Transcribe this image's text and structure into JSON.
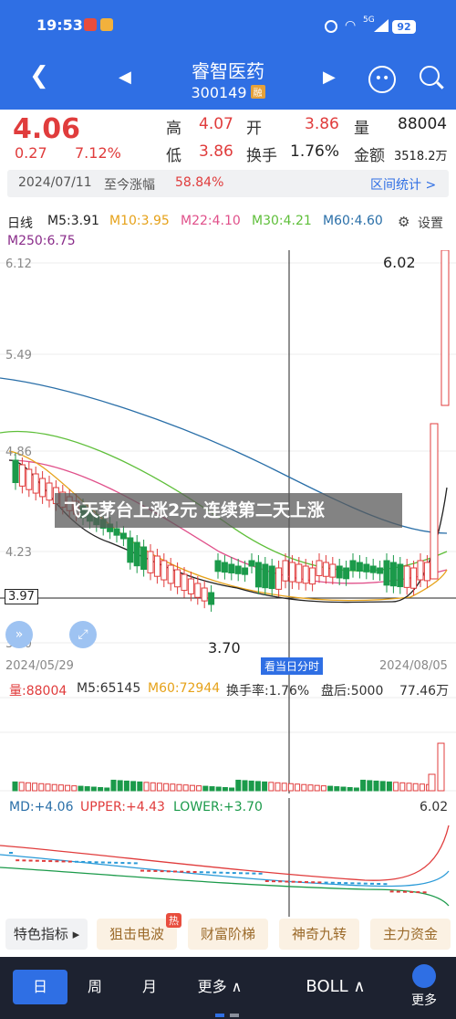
{
  "status_bar": {
    "time": "19:53",
    "network": "5G",
    "battery": "92"
  },
  "nav": {
    "title": "睿智医药",
    "code": "300149",
    "badge": "融"
  },
  "quote": {
    "price": "4.06",
    "change": "0.27",
    "change_pct": "7.12%",
    "high_label": "高",
    "high": "4.07",
    "open_label": "开",
    "open": "3.86",
    "vol_label": "量",
    "vol": "88004",
    "low_label": "低",
    "low": "3.86",
    "turnover_label": "换手",
    "turnover": "1.76%",
    "amount_label": "金额",
    "amount": "3518.2万"
  },
  "info": {
    "date": "2024/07/11",
    "since_label": "至今涨幅",
    "since_value": "58.84%",
    "interval_link": "区间统计 >"
  },
  "ma_row": {
    "kline": "日线",
    "ma5": "M5:3.91",
    "ma10": "M10:3.95",
    "ma22": "M22:4.10",
    "ma30": "M30:4.21",
    "ma60": "M60:4.60",
    "ma250": "M250:6.75",
    "settings": "设置"
  },
  "kchart": {
    "y_labels": [
      "6.12",
      "5.49",
      "4.86",
      "4.23",
      "3.60"
    ],
    "cross_value": "3.97",
    "max_label": "6.02",
    "min_label": "3.70",
    "date_start": "2024/05/29",
    "date_end": "2024/08/05",
    "intraday_button": "看当日分时"
  },
  "banner": "飞天茅台上涨2元 连续第二天上涨",
  "volume": {
    "vol": "量:88004",
    "m5": "M5:65145",
    "m60": "M60:72944",
    "turnover": "换手率:1.76%",
    "after": "盘后:5000",
    "max": "77.46万"
  },
  "boll": {
    "md": "MD:+4.06",
    "upper": "UPPER:+4.43",
    "lower": "LOWER:+3.70",
    "max": "6.02"
  },
  "buttons": {
    "feature": "特色指标 ▸",
    "b1": "狙击电波",
    "hot": "热",
    "b2": "财富阶梯",
    "b3": "神奇九转",
    "b4": "主力资金"
  },
  "bottom": {
    "day": "日",
    "week": "周",
    "month": "月",
    "more1": "更多 ∧",
    "boll": "BOLL ∧",
    "more2": "更多"
  },
  "colors": {
    "up": "#e03c3c",
    "down": "#1b9a4a",
    "brand": "#2f6fe4"
  }
}
